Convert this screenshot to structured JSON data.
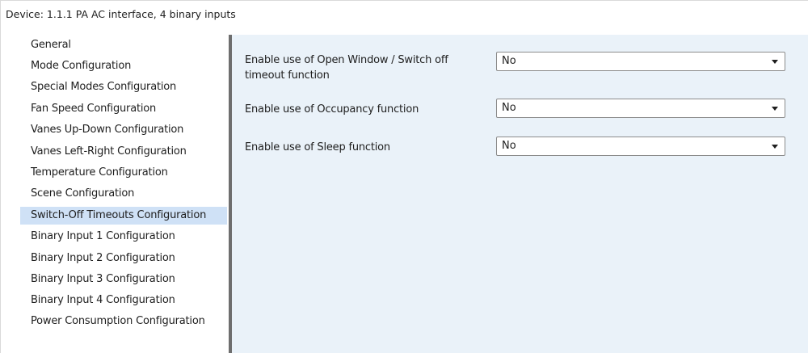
{
  "header": {
    "device_title": "Device: 1.1.1  PA AC interface, 4 binary inputs"
  },
  "sidebar": {
    "selected_index": 8,
    "selected_color": "#cfe1f6",
    "items": [
      {
        "label": "General"
      },
      {
        "label": "Mode Configuration"
      },
      {
        "label": "Special Modes Configuration"
      },
      {
        "label": "Fan Speed Configuration"
      },
      {
        "label": "Vanes Up-Down Configuration"
      },
      {
        "label": "Vanes Left-Right Configuration"
      },
      {
        "label": "Temperature Configuration"
      },
      {
        "label": "Scene Configuration"
      },
      {
        "label": "Switch-Off Timeouts Configuration"
      },
      {
        "label": "Binary Input 1 Configuration"
      },
      {
        "label": "Binary Input 2 Configuration"
      },
      {
        "label": "Binary Input 3 Configuration"
      },
      {
        "label": "Binary Input 4 Configuration"
      },
      {
        "label": "Power Consumption Configuration"
      }
    ]
  },
  "content": {
    "background": "#eaf2f9",
    "params": [
      {
        "label": "Enable use of Open Window / Switch off timeout function",
        "value": "No"
      },
      {
        "label": "Enable use of Occupancy function",
        "value": "No"
      },
      {
        "label": "Enable use of Sleep function",
        "value": "No"
      }
    ]
  }
}
